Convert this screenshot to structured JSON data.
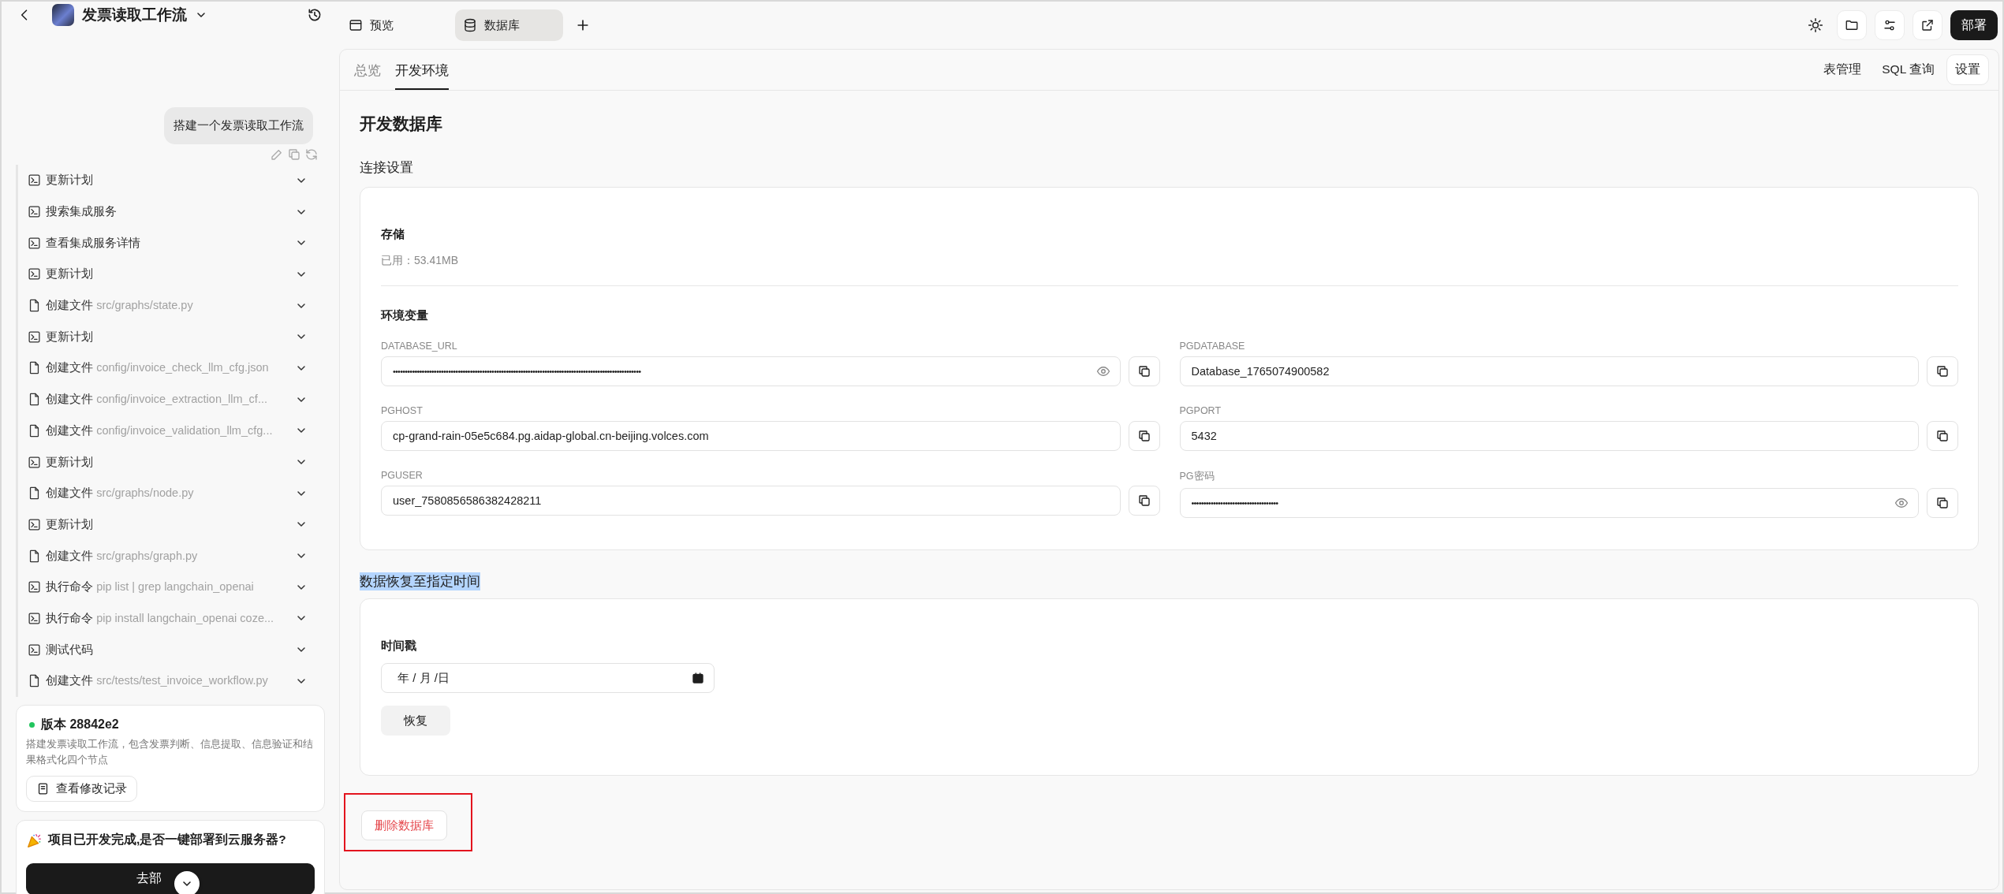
{
  "sidebar": {
    "title": "发票读取工作流",
    "user_message": "搭建一个发票读取工作流",
    "steps": [
      {
        "kind": "terminal",
        "label": "更新计划",
        "expanded": false
      },
      {
        "kind": "terminal",
        "label": "搜索集成服务",
        "expanded": false
      },
      {
        "kind": "terminal",
        "label": "查看集成服务详情",
        "expanded": false
      },
      {
        "kind": "terminal",
        "label": "更新计划",
        "expanded": false
      },
      {
        "kind": "file",
        "label": "创建文件",
        "detail": "src/graphs/state.py",
        "expanded": false
      },
      {
        "kind": "terminal",
        "label": "更新计划",
        "expanded": false
      },
      {
        "kind": "file",
        "label": "创建文件",
        "detail": "config/invoice_check_llm_cfg.json",
        "expanded": false
      },
      {
        "kind": "file",
        "label": "创建文件",
        "detail": "config/invoice_extraction_llm_cf...",
        "expanded": false
      },
      {
        "kind": "file",
        "label": "创建文件",
        "detail": "config/invoice_validation_llm_cfg...",
        "expanded": false
      },
      {
        "kind": "terminal",
        "label": "更新计划",
        "expanded": false
      },
      {
        "kind": "file",
        "label": "创建文件",
        "detail": "src/graphs/node.py",
        "expanded": false
      },
      {
        "kind": "terminal",
        "label": "更新计划",
        "expanded": false
      },
      {
        "kind": "file",
        "label": "创建文件",
        "detail": "src/graphs/graph.py",
        "expanded": false
      },
      {
        "kind": "terminal",
        "label": "执行命令",
        "detail": "pip list | grep langchain_openai",
        "expanded": false
      },
      {
        "kind": "terminal",
        "label": "执行命令",
        "detail": "pip install langchain_openai coze...",
        "expanded": false
      },
      {
        "kind": "terminal",
        "label": "测试代码",
        "expanded": false
      },
      {
        "kind": "file",
        "label": "创建文件",
        "detail": "src/tests/test_invoice_workflow.py",
        "expanded": false
      }
    ],
    "version_card": {
      "title": "版本 28842e2",
      "color": "#22c55e",
      "description": "搭建发票读取工作流，包含发票判断、信息提取、信息验证和结果格式化四个节点",
      "button": "查看修改记录"
    },
    "deploy_card": {
      "text": "项目已开发完成,是否一键部署到云服务器?",
      "button": "去部"
    }
  },
  "tabs": [
    {
      "label": "预览",
      "kind": "preview",
      "selected": false
    },
    {
      "label": "数据库",
      "kind": "database",
      "selected": true
    }
  ],
  "deploy_button": "部署",
  "subtabs": [
    {
      "label": "总览",
      "selected": false
    },
    {
      "label": "开发环境",
      "selected": true
    }
  ],
  "db_tabs": [
    {
      "label": "表管理",
      "selected": false
    },
    {
      "label": "SQL 查询",
      "selected": false
    },
    {
      "label": "设置",
      "selected": true
    }
  ],
  "title": "开发数据库",
  "connection": {
    "heading": "连接设置",
    "storage_label": "存储",
    "storage_used": "已用：53.41MB",
    "env_heading": "环境变量",
    "vars": [
      {
        "name": "DATABASE_URL",
        "value": "•••••••••••••••••••••••••••••••••••••••••••••••••••••••••••••••••••••••••••••••••••••••••••••••••••••••",
        "masked": true
      },
      {
        "name": "PGDATABASE",
        "value": "Database_1765074900582",
        "masked": false
      },
      {
        "name": "PGHOST",
        "value": "cp-grand-rain-05e5c684.pg.aidap-global.cn-beijing.volces.com",
        "masked": false
      },
      {
        "name": "PGPORT",
        "value": "5432",
        "masked": false
      },
      {
        "name": "PGUSER",
        "value": "user_7580856586382428211",
        "masked": false
      },
      {
        "name": "PG密码",
        "value": "••••••••••••••••••••••••••••••••••••",
        "masked": true
      }
    ]
  },
  "restore": {
    "heading": "数据恢复至指定时间",
    "highlighted": true,
    "label": "时间戳",
    "placeholder": "年 / 月 /日",
    "button": "恢复"
  },
  "delete": {
    "button": "删除数据库",
    "annotated": true
  }
}
